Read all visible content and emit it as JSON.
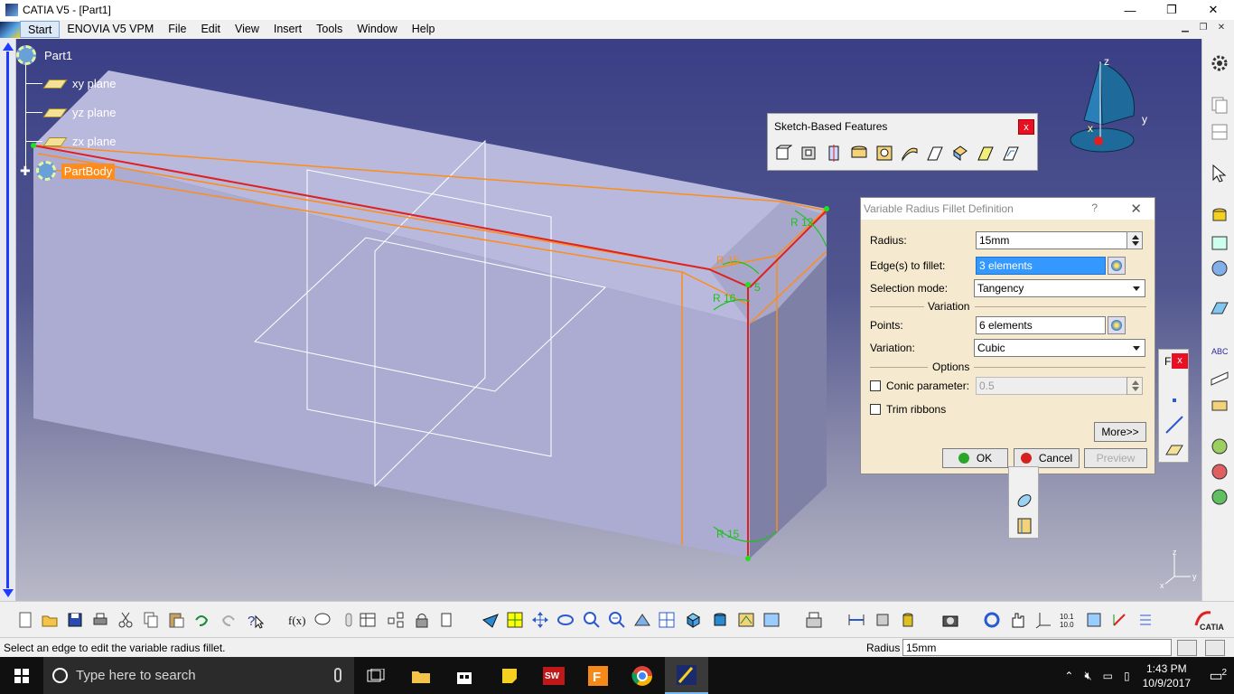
{
  "window": {
    "title": "CATIA V5 - [Part1]",
    "min": "—",
    "max": "❐",
    "close": "✕"
  },
  "menu": {
    "items": [
      "Start",
      "ENOVIA V5 VPM",
      "File",
      "Edit",
      "View",
      "Insert",
      "Tools",
      "Window",
      "Help"
    ]
  },
  "tree": {
    "root": "Part1",
    "nodes": [
      "xy plane",
      "yz plane",
      "zx plane"
    ],
    "body": "PartBody"
  },
  "axis": {
    "x": "x",
    "y": "y",
    "z": "z"
  },
  "model_labels": {
    "r15a": "R 15",
    "r15b": "R 15",
    "r16": "R 16",
    "r12": "R 12",
    "r15c": "R 15",
    "s": "5"
  },
  "sketch_toolbar": {
    "title": "Sketch-Based Features",
    "close": "x",
    "icons": [
      "pad-icon",
      "pocket-icon",
      "shaft-icon",
      "groove-icon",
      "hole-icon",
      "rib-icon",
      "slot-icon",
      "stiffener-icon",
      "multi-section-solid-icon",
      "removed-multi-section-icon"
    ]
  },
  "dialog": {
    "title": "Variable Radius Fillet Definition",
    "help": "?",
    "close": "✕",
    "radius_label": "Radius:",
    "radius_value": "15mm",
    "edges_label": "Edge(s) to fillet:",
    "edges_value": "3 elements",
    "selmode_label": "Selection mode:",
    "selmode_value": "Tangency",
    "variation_header": "Variation",
    "points_label": "Points:",
    "points_value": "6 elements",
    "variation_label": "Variation:",
    "variation_value": "Cubic",
    "options_header": "Options",
    "conic_label": "Conic parameter:",
    "conic_value": "0.5",
    "trim_label": "Trim ribbons",
    "more_label": "More>>",
    "ok_label": "OK",
    "cancel_label": "Cancel",
    "preview_label": "Preview"
  },
  "smallbar": {
    "title": "F",
    "close": "x"
  },
  "status": {
    "message": "Select an edge to edit the variable radius fillet.",
    "radius_label": "Radius",
    "radius_value": "15mm"
  },
  "taskbar": {
    "search_placeholder": "Type here to search",
    "time": "1:43 PM",
    "date": "10/9/2017",
    "notification_count": "2"
  },
  "colors": {
    "viewport_top": "#3a3f86",
    "selection": "#ff8c1a",
    "edge": "#e02020",
    "fillet_preview": "#ff8c1a",
    "dialog_bg": "#f5e9cf"
  }
}
